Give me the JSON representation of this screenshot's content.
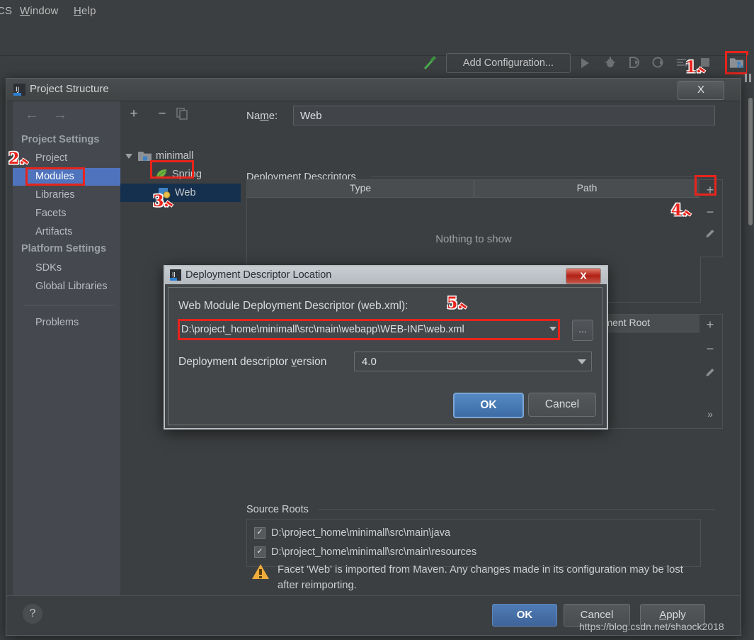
{
  "ide": {
    "menubar": [
      {
        "label": "CS",
        "underline": "S"
      },
      {
        "label": "Window",
        "underline": "W"
      },
      {
        "label": "Help",
        "underline": "H"
      }
    ],
    "toolbar": {
      "hammer_icon": "hammer-build-icon",
      "add_configuration": "Add Configuration...",
      "run_icon": "run-play-icon",
      "debug_icon": "debug-bug-icon",
      "run_coverage_icon": "run-with-coverage-icon",
      "profile_icon": "profiler-icon",
      "run_anything_icon": "run-anything-icon",
      "stop_icon": "stop-square-icon",
      "project_structure_icon": "project-structure-icon"
    }
  },
  "project_structure": {
    "title": "Project Structure",
    "title_icon": "intellij-idea-icon",
    "close_label": "X",
    "nav": {
      "back_icon": "arrow-left-icon",
      "forward_icon": "arrow-right-icon"
    },
    "sidebar": {
      "groups": [
        {
          "header": "Project Settings",
          "items": [
            {
              "label": "Project",
              "selected": false
            },
            {
              "label": "Modules",
              "selected": true,
              "highlighted": true
            },
            {
              "label": "Libraries",
              "selected": false
            },
            {
              "label": "Facets",
              "selected": false
            },
            {
              "label": "Artifacts",
              "selected": false
            }
          ]
        },
        {
          "header": "Platform Settings",
          "items": [
            {
              "label": "SDKs",
              "selected": false
            },
            {
              "label": "Global Libraries",
              "selected": false
            }
          ]
        }
      ],
      "extra_items": [
        {
          "label": "Problems",
          "selected": false
        }
      ]
    },
    "tree": {
      "toolbar": {
        "add": "+",
        "remove": "−",
        "copy_icon": "copy-icon"
      },
      "nodes": [
        {
          "label": "minimall",
          "icon": "module-folder-icon",
          "depth": 0,
          "expanded": true,
          "selected": false
        },
        {
          "label": "Spring",
          "icon": "spring-leaf-icon",
          "depth": 1,
          "selected": false
        },
        {
          "label": "Web",
          "icon": "web-facet-icon",
          "depth": 1,
          "selected": true,
          "highlighted": true
        }
      ]
    },
    "content": {
      "name_label": "Name:",
      "name_label_underline": "m",
      "name_value": "Web",
      "deployment_descriptors": {
        "section_title": "Deployment Descriptors",
        "columns": [
          "Type",
          "Path"
        ],
        "rows": [],
        "empty_text": "Nothing to show",
        "tools": {
          "add": "+",
          "remove": "−",
          "edit_icon": "pencil-edit-icon"
        }
      },
      "deployment_root": {
        "column": "Deployment Root",
        "tools": {
          "add": "+",
          "remove": "−",
          "edit_icon": "pencil-edit-icon",
          "more": "»"
        }
      },
      "source_roots": {
        "section_title": "Source Roots",
        "items": [
          {
            "path": "D:\\project_home\\minimall\\src\\main\\java",
            "checked": true
          },
          {
            "path": "D:\\project_home\\minimall\\src\\main\\resources",
            "checked": true
          }
        ]
      },
      "warning": {
        "icon": "warning-triangle-icon",
        "text": "Facet 'Web' is imported from Maven. Any changes made in its configuration may be lost after reimporting."
      }
    },
    "bottom_bar": {
      "help_icon": "question-mark-icon",
      "ok": "OK",
      "cancel": "Cancel",
      "apply": "Apply",
      "apply_underline": "A"
    }
  },
  "descriptor_dialog": {
    "title": "Deployment Descriptor Location",
    "title_icon": "intellij-idea-icon",
    "close_label": "X",
    "path_label": "Web Module Deployment Descriptor (web.xml):",
    "path_value": "D:\\project_home\\minimall\\src\\main\\webapp\\WEB-INF\\web.xml",
    "browse_label": "...",
    "version_label": "Deployment descriptor version",
    "version_label_underline": "v",
    "version_value": "4.0",
    "ok": "OK",
    "cancel": "Cancel"
  },
  "callouts": [
    {
      "number": "1.",
      "target": "project-structure-toolbar-button"
    },
    {
      "number": "2.",
      "target": "sidebar-item-modules"
    },
    {
      "number": "3.",
      "target": "tree-node-web"
    },
    {
      "number": "4.",
      "target": "deployment-descriptor-add-button"
    },
    {
      "number": "5.",
      "target": "descriptor-path-field"
    }
  ],
  "watermark": "https://blog.csdn.net/shaock2018",
  "colors": {
    "accent_blue": "#4f74bd",
    "callout_red": "#e8241c",
    "panel_bg": "#3c3f41",
    "sidebar_bg": "#45494f",
    "warning_amber": "#f0ad3c"
  }
}
